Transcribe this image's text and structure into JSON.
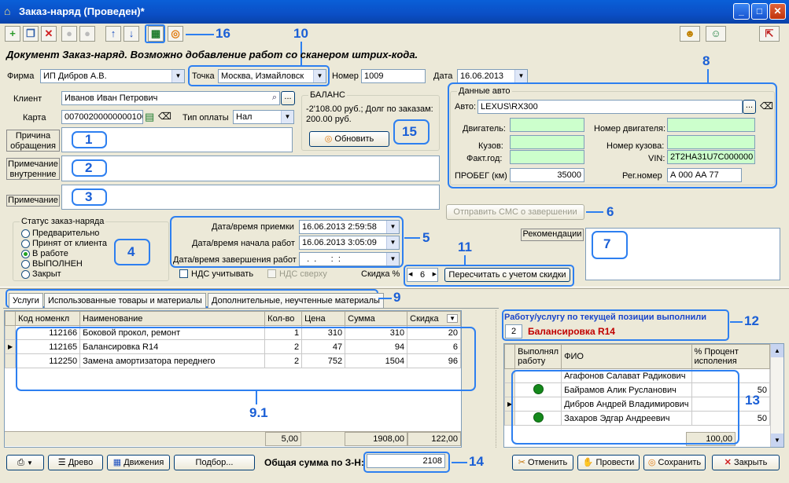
{
  "window": {
    "title": "Заказ-наряд (Проведен)*"
  },
  "toolbar": {
    "marker16": "16",
    "marker10": "10"
  },
  "header_text": "Документ Заказ-наряд. Возможно добавление работ со сканером штрих-кода.",
  "fields": {
    "firm_label": "Фирма",
    "firm_value": "ИП Дибров А.В.",
    "point_label": "Точка",
    "point_value": "Москва, Измайловск",
    "number_label": "Номер",
    "number_value": "1009",
    "date_label": "Дата",
    "date_value": "16.06.2013",
    "client_label": "Клиент",
    "client_value": "Иванов Иван Петрович",
    "card_label": "Карта",
    "card_value": "00700200000000100",
    "pay_label": "Тип оплаты",
    "pay_value": "Нал"
  },
  "balance": {
    "title": "БАЛАНС",
    "text": "-2'108.00 руб.; Долг по заказам: 200.00 руб.",
    "refresh": "Обновить",
    "marker": "15"
  },
  "car": {
    "title": "Данные авто",
    "auto_label": "Авто:",
    "auto_value": "LEXUS\\RX300",
    "engine_label": "Двигатель:",
    "engine_no_label": "Номер двигателя:",
    "body_label": "Кузов:",
    "body_no_label": "Номер кузова:",
    "year_label": "Факт.год:",
    "vin_label": "VIN:",
    "vin_value": "2T2HA31U7C000000",
    "mileage_label": "ПРОБЕГ (км)",
    "mileage_value": "35000",
    "reg_label": "Рег.номер",
    "reg_value": "А 000 АА 77",
    "marker": "8"
  },
  "notes": {
    "reason": "Причина обращения",
    "internal": "Примечание внутренние",
    "note": "Примечание",
    "m1": "1",
    "m2": "2",
    "m3": "3"
  },
  "sms": {
    "label": "Отправить СМС о завершении",
    "marker": "6"
  },
  "status": {
    "title": "Статус заказ-наряда",
    "options": [
      "Предварительно",
      "Принят от клиента",
      "В работе",
      "ВЫПОЛНЕН",
      "Закрыт"
    ],
    "selected": "В работе",
    "marker": "4"
  },
  "dates": {
    "recv_label": "Дата/время приемки",
    "recv_value": "16.06.2013 2:59:58",
    "start_label": "Дата/время начала работ",
    "start_value": "16.06.2013 3:05:09",
    "end_label": "Дата/время завершения работ",
    "end_value": "  .  .      :  :",
    "marker": "5"
  },
  "recommend": {
    "label": "Рекомендации",
    "marker": "7"
  },
  "vat": {
    "nds": "НДС учитывать",
    "nds_over": "НДС сверху",
    "discount_label": "Скидка %",
    "discount_value": "6",
    "recalc": "Пересчитать с учетом скидки",
    "marker": "11"
  },
  "tabs": {
    "items": [
      "Услуги",
      "Использованные товары и материалы",
      "Дополнительные, неучтенные материалы"
    ],
    "marker": "9"
  },
  "services": {
    "headers": [
      "Код номенкл",
      "Наименование",
      "Кол-во",
      "Цена",
      "Сумма",
      "Скидка"
    ],
    "rows": [
      [
        "112166",
        "Боковой прокол, ремонт",
        "1",
        "310",
        "310",
        "20"
      ],
      [
        "112165",
        "Балансировка R14",
        "2",
        "47",
        "94",
        "6"
      ],
      [
        "112250",
        "Замена амортизатора переднего",
        "2",
        "752",
        "1504",
        "96"
      ]
    ],
    "totals": {
      "qty": "5,00",
      "sum": "1908,00",
      "disc": "122,00"
    },
    "marker": "9.1"
  },
  "performed": {
    "title": "Работу/услугу по текущей позиции выполнили",
    "qty": "2",
    "service": "Балансировка R14",
    "marker": "12"
  },
  "workers": {
    "headers": [
      "Выполнял работу",
      "ФИО",
      "% Процент исполения"
    ],
    "rows": [
      [
        "Агафонов Салават Радикович",
        "",
        false
      ],
      [
        "Байрамов Алик Русланович",
        "50",
        true
      ],
      [
        "Дибров Андрей Владимирович",
        "",
        false
      ],
      [
        "Захаров Эдгар Андреевич",
        "50",
        true
      ]
    ],
    "total": "100,00",
    "marker": "13"
  },
  "footer": {
    "tree": "Древо",
    "moves": "Движения",
    "select": "Подбор...",
    "total_label": "Общая сумма по З-Н:",
    "total_value": "2108",
    "marker": "14",
    "cancel": "Отменить",
    "post": "Провести",
    "save": "Сохранить",
    "close": "Закрыть"
  }
}
